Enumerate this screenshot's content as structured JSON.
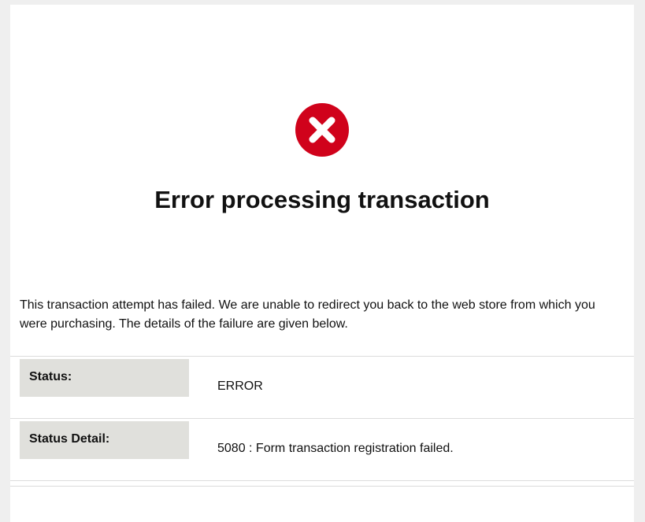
{
  "page": {
    "title": "Error processing transaction",
    "icon": "error-x-circle-icon",
    "colors": {
      "error_icon": "#d0021b",
      "label_bg": "#e0e0dc",
      "page_bg": "#efefef"
    }
  },
  "message": "This transaction attempt has failed. We are unable to redirect you back to the web store from which you were purchasing. The details of the failure are given below.",
  "details": {
    "status": {
      "label": "Status:",
      "value": "ERROR"
    },
    "status_detail": {
      "label": "Status Detail:",
      "value": "5080 : Form transaction registration failed."
    }
  }
}
